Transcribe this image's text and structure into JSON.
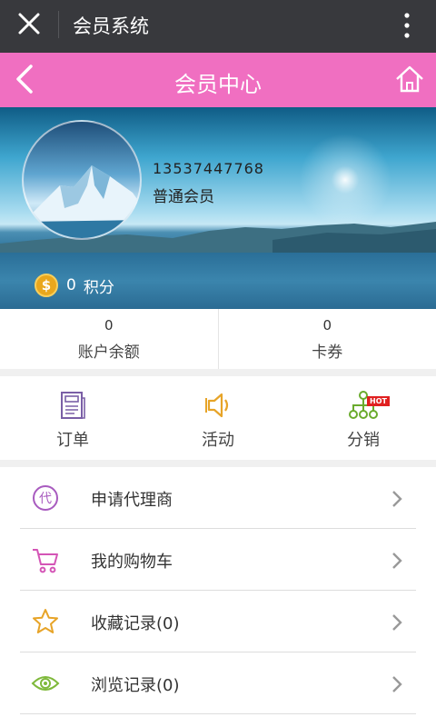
{
  "topbar": {
    "title": "会员系统",
    "close_icon": "close-icon",
    "more_icon": "more-vertical-icon"
  },
  "header": {
    "title": "会员中心",
    "back_icon": "chevron-left-icon",
    "home_icon": "home-icon"
  },
  "profile": {
    "phone": "13537447768",
    "level": "普通会员",
    "points_value": "0",
    "points_label": "积分",
    "coin_symbol": "$"
  },
  "stats": [
    {
      "value": "0",
      "label": "账户余额"
    },
    {
      "value": "0",
      "label": "卡券"
    }
  ],
  "quick": [
    {
      "label": "订单",
      "icon": "order-icon"
    },
    {
      "label": "活动",
      "icon": "speaker-icon"
    },
    {
      "label": "分销",
      "icon": "distribution-icon",
      "badge": "HOT"
    }
  ],
  "menu": [
    {
      "label": "申请代理商",
      "icon": "agent-icon",
      "icon_text": "代"
    },
    {
      "label": "我的购物车",
      "icon": "cart-icon"
    },
    {
      "label": "收藏记录(0)",
      "icon": "star-icon"
    },
    {
      "label": "浏览记录(0)",
      "icon": "eye-icon"
    }
  ],
  "colors": {
    "header": "#f06fc1",
    "topbar": "#38393d",
    "order": "#7a5fa6",
    "activity": "#e7a428",
    "distribution": "#6aab2d",
    "agent": "#a85bbf",
    "cart": "#d455b6",
    "star": "#e7a428",
    "eye": "#7fb93b"
  }
}
